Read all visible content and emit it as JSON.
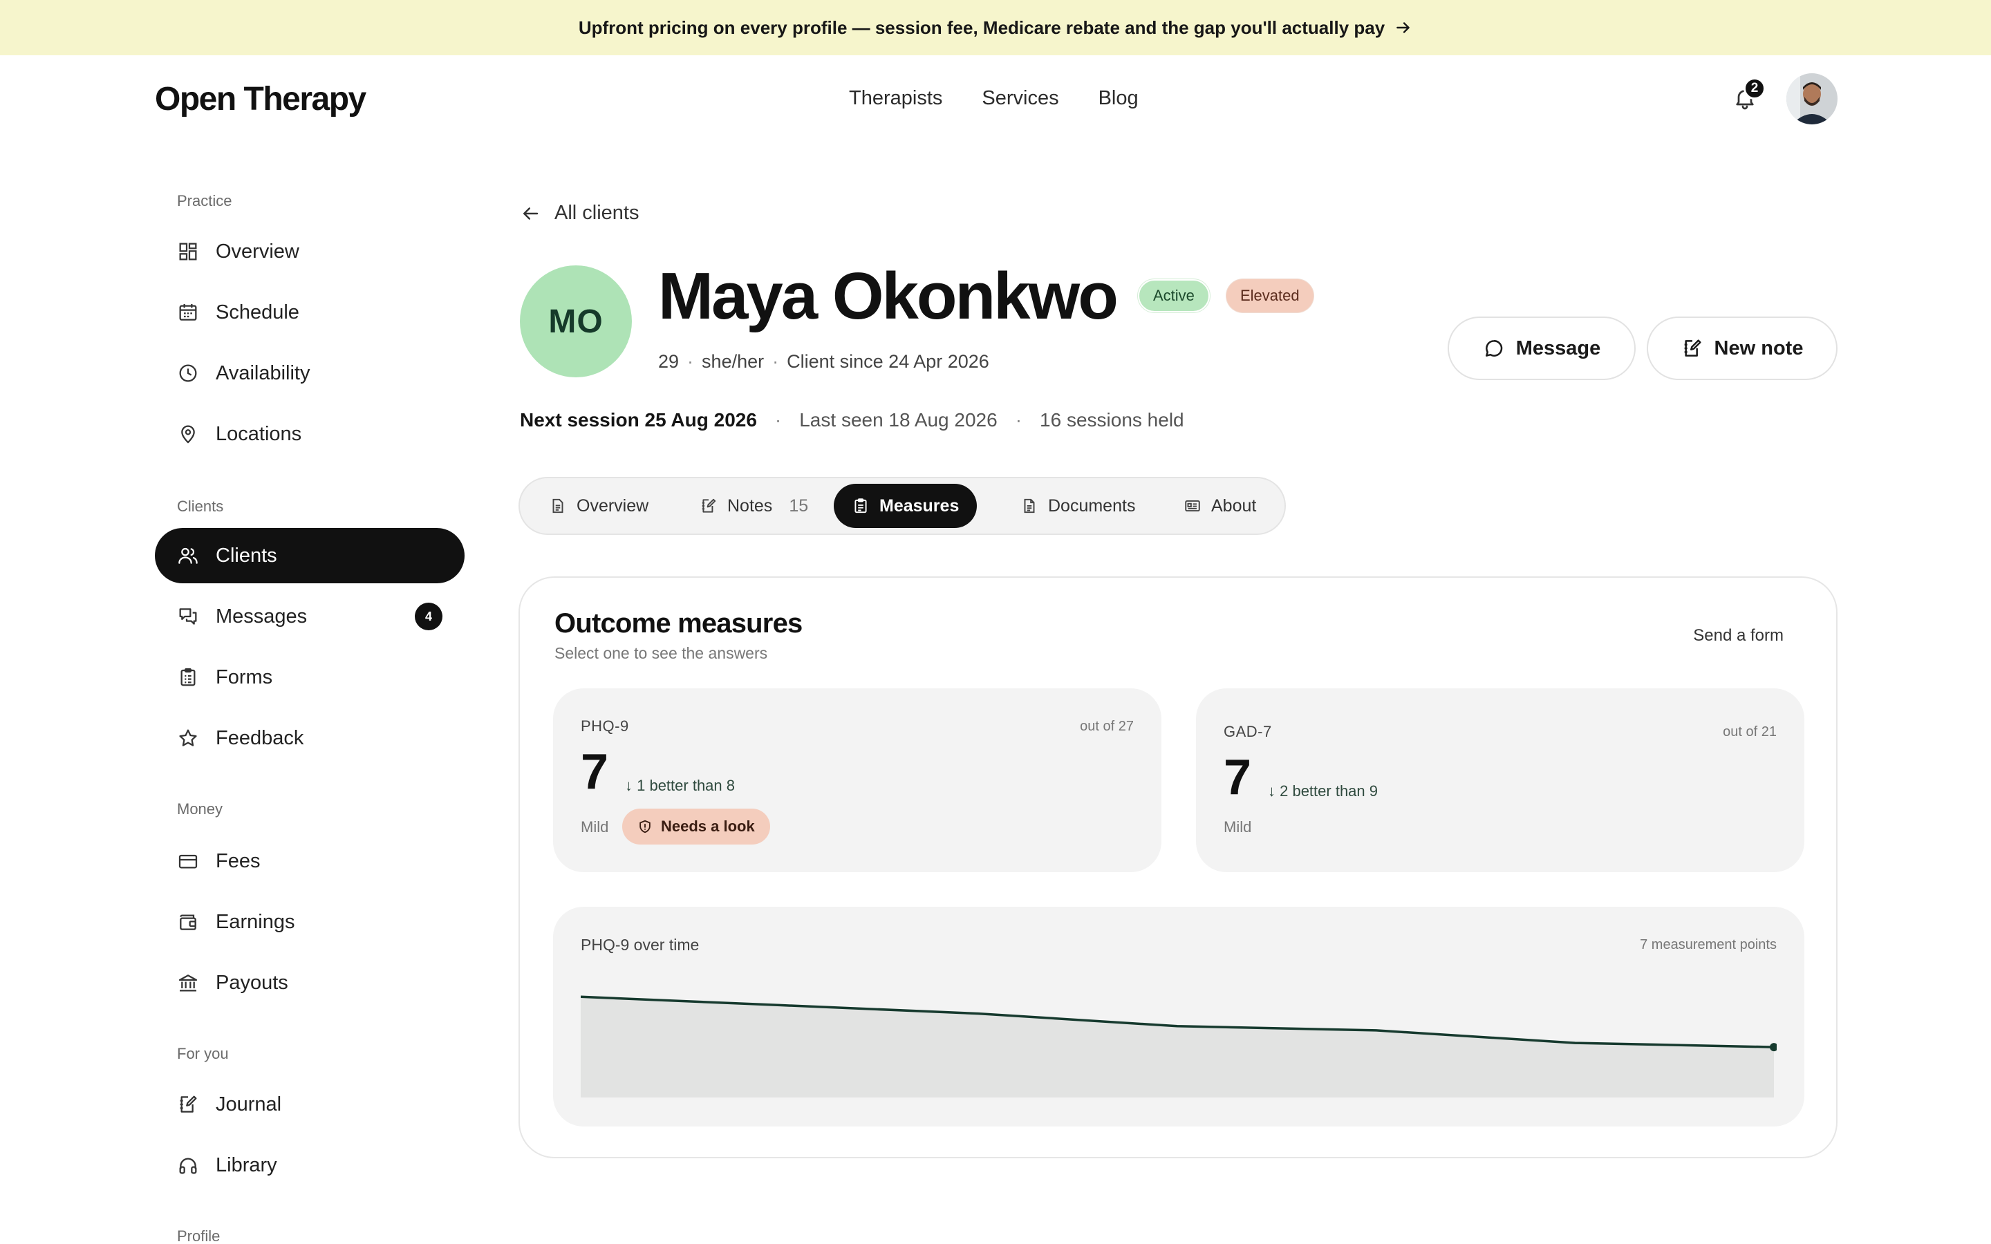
{
  "banner": {
    "text": "Upfront pricing on every profile — session fee, Medicare rebate and the gap you'll actually pay"
  },
  "brand": {
    "name": "Open Therapy"
  },
  "topnav": {
    "items": [
      "Therapists",
      "Services",
      "Blog"
    ]
  },
  "notifications": {
    "count": "2"
  },
  "sidebar": {
    "sections": [
      {
        "label": "Practice",
        "items": [
          {
            "label": "Overview",
            "icon": "grid-icon"
          },
          {
            "label": "Schedule",
            "icon": "calendar-icon"
          },
          {
            "label": "Availability",
            "icon": "clock-icon"
          },
          {
            "label": "Locations",
            "icon": "map-pin-icon"
          }
        ]
      },
      {
        "label": "Clients",
        "items": [
          {
            "label": "Clients",
            "icon": "users-icon",
            "active": true
          },
          {
            "label": "Messages",
            "icon": "chat-icon",
            "badge": "4"
          },
          {
            "label": "Forms",
            "icon": "clipboard-icon"
          },
          {
            "label": "Feedback",
            "icon": "star-icon"
          }
        ]
      },
      {
        "label": "Money",
        "items": [
          {
            "label": "Fees",
            "icon": "card-icon"
          },
          {
            "label": "Earnings",
            "icon": "wallet-icon"
          },
          {
            "label": "Payouts",
            "icon": "bank-icon"
          }
        ]
      },
      {
        "label": "For you",
        "items": [
          {
            "label": "Journal",
            "icon": "journal-icon"
          },
          {
            "label": "Library",
            "icon": "headphones-icon"
          }
        ]
      },
      {
        "label": "Profile",
        "items": []
      }
    ]
  },
  "client": {
    "back_label": "All clients",
    "initials": "MO",
    "name": "Maya Okonkwo",
    "status_badge": "Active",
    "risk_badge": "Elevated",
    "age": "29",
    "pronouns": "she/her",
    "since": "Client since 24 Apr 2026",
    "next_session": "Next session 25 Aug 2026",
    "last_seen": "Last seen 18 Aug 2026",
    "sessions_held": "16 sessions held",
    "message_label": "Message",
    "new_note_label": "New note"
  },
  "tabs": [
    {
      "label": "Overview",
      "icon": "document-icon"
    },
    {
      "label": "Notes",
      "icon": "edit-note-icon",
      "count": "15"
    },
    {
      "label": "Measures",
      "icon": "clipboard-check-icon",
      "active": true
    },
    {
      "label": "Documents",
      "icon": "file-icon"
    },
    {
      "label": "About",
      "icon": "id-card-icon"
    }
  ],
  "measures": {
    "title": "Outcome measures",
    "subtitle": "Select one to see the answers",
    "send_form": "Send a form",
    "phq": {
      "name": "PHQ-9",
      "out_of": "out of 27",
      "score": "7",
      "delta": "↓ 1 better than 8",
      "severity": "Mild",
      "flag": "Needs a look"
    },
    "gad": {
      "name": "GAD-7",
      "out_of": "out of 21",
      "score": "7",
      "delta": "↓ 2 better than 9",
      "severity": "Mild"
    },
    "chart_title": "PHQ-9 over time",
    "chart_points_label": "7 measurement points"
  },
  "chart_data": {
    "type": "area",
    "title": "PHQ-9 over time",
    "x": [
      1,
      2,
      3,
      4,
      5,
      6,
      7
    ],
    "series": [
      {
        "values": [
          12,
          11,
          10,
          8.5,
          8,
          6.5,
          6
        ]
      }
    ],
    "ylim": [
      0,
      14
    ],
    "grid": false,
    "colors": {
      "line": "#163a2e",
      "fill": "#e2e3e2"
    }
  },
  "colors": {
    "banner": "#f6f5cc",
    "accent_dark": "#111111",
    "success": "#b7e6bd",
    "warning": "#f4cdbd",
    "avatar": "#aee3b6"
  }
}
